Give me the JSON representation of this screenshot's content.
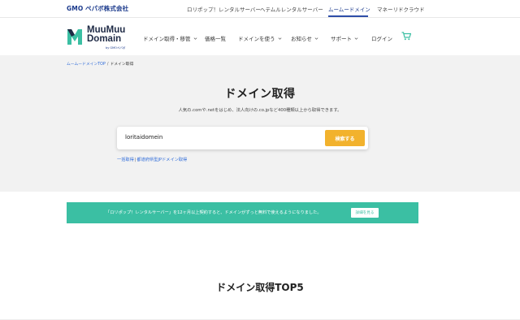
{
  "gmo_bar": {
    "logo": "GMO ペパボ株式会社",
    "links": [
      {
        "label": "ロリポップ！レンタルサーバー"
      },
      {
        "label": "ヘテムルレンタルサーバー"
      },
      {
        "label": "ムームードメイン"
      },
      {
        "label": "マネーリドクラウド"
      }
    ]
  },
  "header": {
    "logo_line1": "MuuMuu",
    "logo_line2": "Domain",
    "logo_sub": "by GMOペパボ",
    "nav": [
      {
        "label": "ドメイン取得・移管",
        "has_dropdown": true
      },
      {
        "label": "価格一覧",
        "has_dropdown": false
      },
      {
        "label": "ドメインを使う",
        "has_dropdown": true
      },
      {
        "label": "お知らせ",
        "has_dropdown": true
      },
      {
        "label": "サポート",
        "has_dropdown": true
      },
      {
        "label": "ログイン",
        "has_dropdown": false
      }
    ],
    "cart_icon": "cart-icon"
  },
  "breadcrumb": {
    "home": "ムームードメインTOP",
    "separator": "/",
    "current": "ドメイン取得"
  },
  "hero": {
    "title": "ドメイン取得",
    "description": "人気の.comや.netをはじめ、法人向けの.co.jpなど400種類以上から取得できます。",
    "search_value": "loritaidomein",
    "search_button": "検索する",
    "link1": "一括取得",
    "link_sep": "|",
    "link2": "都道府県型JPドメイン取得"
  },
  "promo": {
    "text": "「ロリポップ！レンタルサーバー」を12ヶ月以上契約すると、ドメインがずっと無料で使えるようになりました。",
    "button": "詳細を見る"
  },
  "section_title": "ドメイン取得TOP5",
  "colors": {
    "accent": "#3bbfa3",
    "button": "#f2b22d",
    "brand_navy": "#1b3a8c",
    "hero_bg": "#f2f2f2"
  }
}
